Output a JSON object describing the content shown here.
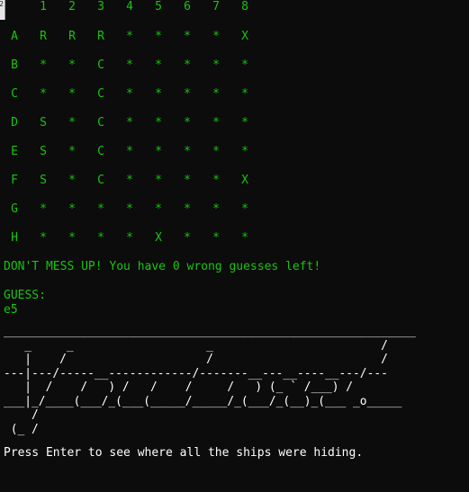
{
  "board": {
    "column_labels": [
      "1",
      "2",
      "3",
      "4",
      "5",
      "6",
      "7",
      "8"
    ],
    "rows": [
      {
        "label": "A",
        "cells": [
          "R",
          "R",
          "R",
          "*",
          "*",
          "*",
          "*",
          "X"
        ]
      },
      {
        "label": "B",
        "cells": [
          "*",
          "*",
          "C",
          "*",
          "*",
          "*",
          "*",
          "*"
        ]
      },
      {
        "label": "C",
        "cells": [
          "*",
          "*",
          "C",
          "*",
          "*",
          "*",
          "*",
          "*"
        ]
      },
      {
        "label": "D",
        "cells": [
          "S",
          "*",
          "C",
          "*",
          "*",
          "*",
          "*",
          "*"
        ]
      },
      {
        "label": "E",
        "cells": [
          "S",
          "*",
          "C",
          "*",
          "*",
          "*",
          "*",
          "*"
        ]
      },
      {
        "label": "F",
        "cells": [
          "S",
          "*",
          "C",
          "*",
          "*",
          "*",
          "*",
          "X"
        ]
      },
      {
        "label": "G",
        "cells": [
          "*",
          "*",
          "*",
          "*",
          "*",
          "*",
          "*",
          "*"
        ]
      },
      {
        "label": "H",
        "cells": [
          "*",
          "*",
          "*",
          "*",
          "X",
          "*",
          "*",
          "*"
        ]
      }
    ]
  },
  "status": {
    "warning": "DON'T MESS UP! You have 0 wrong guesses left!",
    "guess_prompt": "GUESS:",
    "guess_input": "e5"
  },
  "banner_art": "___________________________________________________________\n   _     _                   _                        /\n   |    /                    /                        /\n---|---/-----__------------/-------__---__----__---/---\n   |  /    /   ) /   /    /     /   ) (_ ` /___) /\n___|_/____(___/_(___(_____/_____/_(___/_(__)_(___ _o_____\n    /\n (_ /",
  "footer": {
    "message": "Press Enter to see where all the ships were hiding."
  },
  "colors": {
    "background": "#0c0c0c",
    "console_green": "#16c60c",
    "console_white": "#ffffff"
  }
}
